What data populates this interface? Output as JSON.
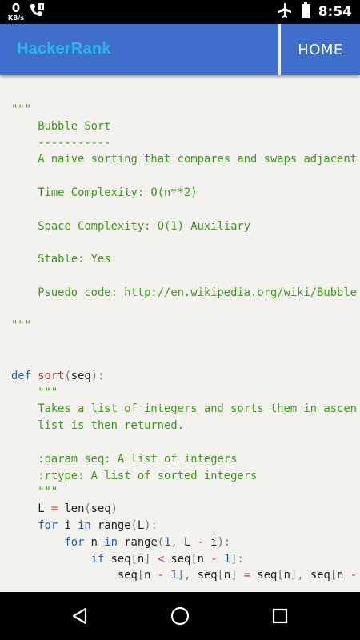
{
  "status_bar": {
    "net_speed_value": "0",
    "net_speed_unit": "KB/s",
    "time": "8:54"
  },
  "app_bar": {
    "brand": "HackerRank",
    "home_label": "HOME"
  },
  "code": {
    "lines": [
      "\"\"\"",
      "    Bubble Sort",
      "    -----------",
      "    A naive sorting that compares and swaps adjacent",
      "",
      "    Time Complexity: O(n**2)",
      "",
      "    Space Complexity: O(1) Auxiliary",
      "",
      "    Stable: Yes",
      "",
      "    Psuedo code: http://en.wikipedia.org/wiki/Bubble",
      "",
      "\"\"\"",
      "",
      "",
      "def sort(seq):",
      "    \"\"\"",
      "    Takes a list of integers and sorts them in ascen",
      "    list is then returned.",
      "",
      "    :param seq: A list of integers",
      "    :rtype: A list of sorted integers",
      "    \"\"\"",
      "    L = len(seq)",
      "    for i in range(L):",
      "        for n in range(1, L - i):",
      "            if seq[n] < seq[n - 1]:",
      "                seq[n - 1], seq[n] = seq[n], seq[n -"
    ]
  },
  "colors": {
    "string": "#3d9a1c",
    "keyword": "#1c5fc0",
    "function": "#c8342f",
    "appbar": "#3f6fcb",
    "brand": "#2bb6e8"
  }
}
